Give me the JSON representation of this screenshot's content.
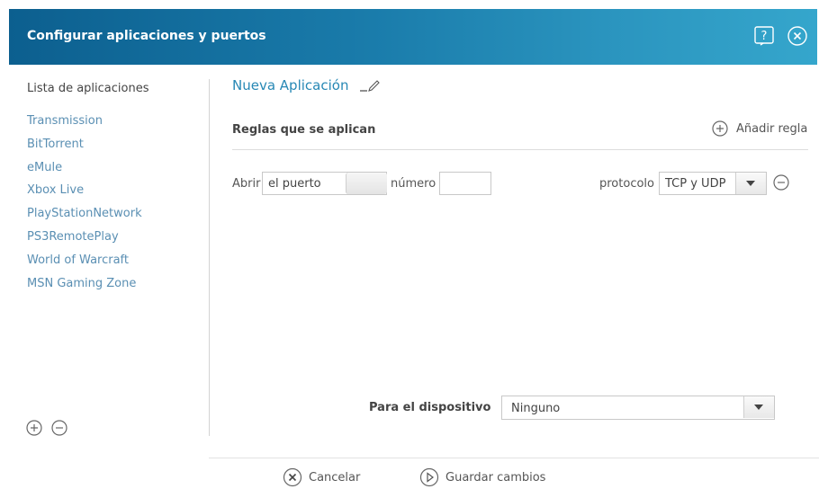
{
  "header": {
    "title": "Configurar aplicaciones y puertos",
    "help_icon": "help-icon",
    "close_icon": "close-icon"
  },
  "sidebar": {
    "title": "Lista de aplicaciones",
    "items": [
      {
        "label": "Transmission"
      },
      {
        "label": "BitTorrent"
      },
      {
        "label": "eMule"
      },
      {
        "label": "Xbox Live"
      },
      {
        "label": "PlayStationNetwork"
      },
      {
        "label": "PS3RemotePlay"
      },
      {
        "label": "World of Warcraft"
      },
      {
        "label": "MSN Gaming Zone"
      }
    ],
    "add_icon": "plus-circle-icon",
    "remove_icon": "minus-circle-icon"
  },
  "main": {
    "app_name": "Nueva Aplicación",
    "edit_icon": "pencil-icon",
    "rules_title": "Reglas que se aplican",
    "add_rule_label": "Añadir regla",
    "rule": {
      "abrir_label": "Abrir",
      "port_type_value": "el puerto",
      "numero_label": "número",
      "port_value": "",
      "protocolo_label": "protocolo",
      "protocol_value": "TCP y UDP"
    },
    "device_label": "Para el dispositivo",
    "device_value": "Ninguno"
  },
  "footer": {
    "cancel_label": "Cancelar",
    "save_label": "Guardar cambios"
  },
  "colors": {
    "header_gradient_start": "#0c5f8f",
    "header_gradient_end": "#35a6cc",
    "link_blue": "#5a8fb3",
    "app_name_blue": "#2788b5"
  }
}
